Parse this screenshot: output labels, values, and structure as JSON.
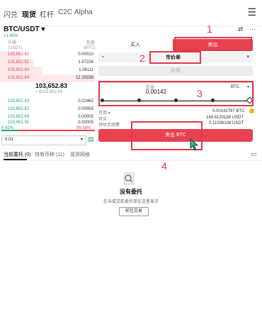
{
  "nav": {
    "tabs": [
      "闪兑",
      "现货",
      "杠杆",
      "C2C",
      "Alpha"
    ],
    "active_tab": "现货"
  },
  "pair": {
    "name": "BTC/USDT",
    "change": "+1.45%"
  },
  "orderbook": {
    "col_price": "价格",
    "col_price_unit": "(USDT)",
    "col_amount": "数量",
    "col_amount_unit": "(BTC)",
    "asks": [
      {
        "price": "103,652.92",
        "amount": "0.00010",
        "depth": 0.22
      },
      {
        "price": "103,652.91",
        "amount": "1.87226",
        "depth": 0.35
      },
      {
        "price": "103,652.90",
        "amount": "1.06111",
        "depth": 0.45
      },
      {
        "price": "103,652.84",
        "amount": "12.25558",
        "depth": 1.0
      }
    ],
    "last_price": "103,652.83",
    "last_price_usd": "≈ $103,652.83",
    "bids": [
      {
        "price": "103,652.83",
        "amount": "0.02462"
      },
      {
        "price": "103,652.82",
        "amount": "0.00055"
      },
      {
        "price": "103,652.69",
        "amount": "0.00005"
      },
      {
        "price": "103,651.35",
        "amount": "0.00005"
      }
    ],
    "buy_ratio": "0.42%",
    "sell_ratio": "99.58%",
    "precision": "0.01"
  },
  "trade": {
    "buy_label": "买入",
    "sell_label": "卖出",
    "order_type": "市价单",
    "price_placeholder": "价格",
    "qty_label": "数量",
    "qty_value": "0.00142",
    "qty_unit": "BTC",
    "available_label": "可用",
    "available_value": "0.00142787 BTC",
    "max_label": "可买",
    "max_value": "148.6120188 USDT",
    "fee_label": "预估手续费",
    "fee_value": "0.11039108 USDT",
    "submit_label": "卖出 BTC"
  },
  "annotations": [
    "1",
    "2",
    "3",
    "4"
  ],
  "orders": {
    "tabs": [
      "当前委托 (0)",
      "持有币种 (11)",
      "现货网格"
    ],
    "empty_title": "没有委托",
    "empty_desc": "在未成交前委托单在这里显示",
    "trade_button": "前往交易"
  },
  "colors": {
    "red": "#e8414f",
    "green": "#1aa46b",
    "annotation": "#e23a48"
  }
}
